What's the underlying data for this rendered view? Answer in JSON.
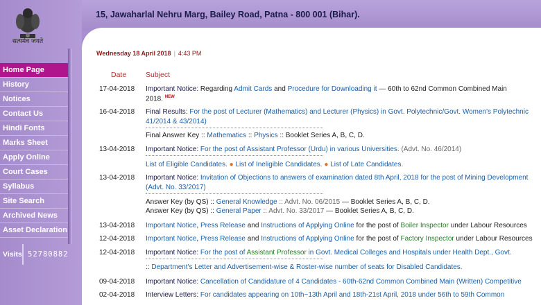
{
  "header": {
    "address": "15, Jawaharlal Nehru Marg, Bailey Road, Patna - 800 001 (Bihar).",
    "emblem_motto": "सत्यमेव जयते"
  },
  "datetime": {
    "date": "Wednesday 18 April 2018",
    "time": "4:43 PM"
  },
  "table_headers": {
    "date": "Date",
    "subject": "Subject"
  },
  "nav": [
    "Home Page",
    "History",
    "Notices",
    "Contact Us",
    "Hindi Fonts",
    "Marks Sheet",
    "Apply Online",
    "Court Cases",
    "Syllabus",
    "Site Search",
    "Archived News",
    "Asset Declaration"
  ],
  "visits": {
    "label": "Visits",
    "count": "52780882"
  },
  "colors": {
    "sidebar": "#a98fcf",
    "active": "#b0158e",
    "link": "#1a5fa8"
  },
  "rows": [
    {
      "date": "17-04-2018",
      "a": "Important Notice: ",
      "b": "Regarding ",
      "c": "Admit Cards",
      "d": " and ",
      "e": "Procedure for Downloading it",
      "f": " — 60th to 62nd Common Combined Main",
      "g": "2018.",
      "h": "NEW"
    },
    {
      "date": "16-04-2018",
      "a": "Final Results: ",
      "b": "For the post of Lecturer (Mathematics) and Lecturer (Physics) in Govt. Polytechnic/Govt. Women's Polytechnic",
      "c": "41/2014 & 43/2014)"
    },
    {
      "a": "Final Answer Key :: ",
      "b": "Mathematics",
      "c": " :: ",
      "d": "Physics",
      "e": " :: Booklet Series A, B, C, D."
    },
    {
      "date": "13-04-2018",
      "a": "Important Notice: ",
      "b": "For the post of Assistant Professor (Urdu) in various Universities.",
      "c": " (Advt. No. 46/2014)"
    },
    {
      "a": "List of Eligible Candidates.",
      "b": "List of Ineligible Candidates.",
      "c": "List of Late Candidates."
    },
    {
      "date": "13-04-2018",
      "a": "Important Notice: ",
      "b": "Invitation of Objections to answers of examination dated 8th April, 2018 for the post of Mining Development",
      "c": "(Advt. No. 33/2017)"
    },
    {
      "a": "Answer Key (by QS) :: ",
      "b": "General Knowledge",
      "c": " :: Advt. No. 06/2015",
      "d": " — Booklet Series A, B, C, D."
    },
    {
      "a": "Answer Key (by QS) :: ",
      "b": "General Paper",
      "c": " :: Advt. No. 33/2017",
      "d": " — Booklet Series A, B, C, D."
    },
    {
      "date": "13-04-2018",
      "a": "Important Notice",
      "b": ", ",
      "c": "Press Release",
      "d": " and ",
      "e": "Instructions of Applying Online",
      "f": " for the post of ",
      "g": "Boiler Inspector",
      "h": " under Labour Resources"
    },
    {
      "date": "12-04-2018",
      "a": "Important Notice",
      "b": ", ",
      "c": "Press Release",
      "d": " and ",
      "e": "Instructions of Applying Online",
      "f": " for the post of ",
      "g": "Factory Inspector",
      "h": " under Labour Resources"
    },
    {
      "date": "12-04-2018",
      "a": "Important Notice: ",
      "b": "For the post of ",
      "c": "Assistant Professor",
      "d": " in Govt. Medical Colleges and Hospitals under Health Dept., Govt."
    },
    {
      "a": ":: ",
      "b": "Department's Letter and Advertisement-wise & Roster-wise number of seats for Disabled Candidates."
    },
    {
      "date": "09-04-2018",
      "a": "Important Notice: ",
      "b": "Cancellation of Candidature of 4 Candidates - 60th-62nd Common Combined Main (Written) Competitive"
    },
    {
      "date": "02-04-2018",
      "a": "Interview Letters: ",
      "b": "For candidates appearing on 10th~13th April and 18th-21st April, 2018 under 56th to 59th Common"
    }
  ]
}
